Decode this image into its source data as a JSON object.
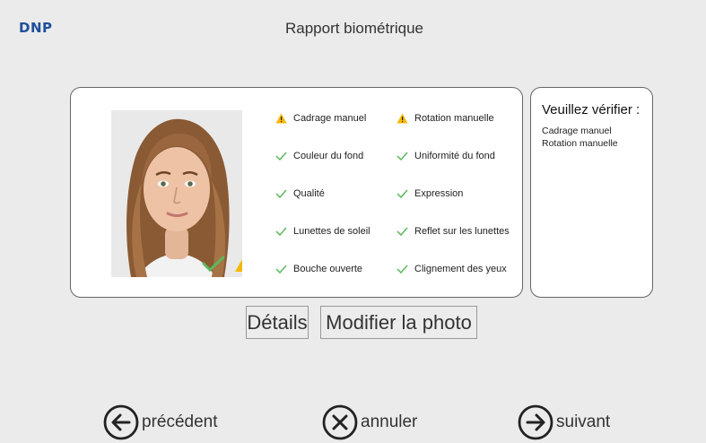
{
  "header": {
    "logo": "DNP",
    "title": "Rapport biométrique"
  },
  "checks": [
    {
      "label": "Cadrage manuel",
      "status": "warning"
    },
    {
      "label": "Rotation manuelle",
      "status": "warning"
    },
    {
      "label": "Couleur du fond",
      "status": "ok"
    },
    {
      "label": "Uniformité du fond",
      "status": "ok"
    },
    {
      "label": "Qualité",
      "status": "ok"
    },
    {
      "label": "Expression",
      "status": "ok"
    },
    {
      "label": "Lunettes de soleil",
      "status": "ok"
    },
    {
      "label": "Reflet sur les lunettes",
      "status": "ok"
    },
    {
      "label": "Bouche ouverte",
      "status": "ok"
    },
    {
      "label": "Clignement des yeux",
      "status": "ok"
    }
  ],
  "verify": {
    "title": "Veuillez vérifier :",
    "items": [
      "Cadrage manuel",
      "Rotation manuelle"
    ]
  },
  "buttons": {
    "details": "Détails",
    "modify": "Modifier la photo"
  },
  "nav": {
    "prev": "précédent",
    "cancel": "annuler",
    "next": "suivant"
  },
  "colors": {
    "logo": "#1e4f9c",
    "ok": "#5cb85c",
    "warning": "#f5b800"
  },
  "icons": {
    "ok": "check-icon",
    "warning": "warning-icon"
  }
}
